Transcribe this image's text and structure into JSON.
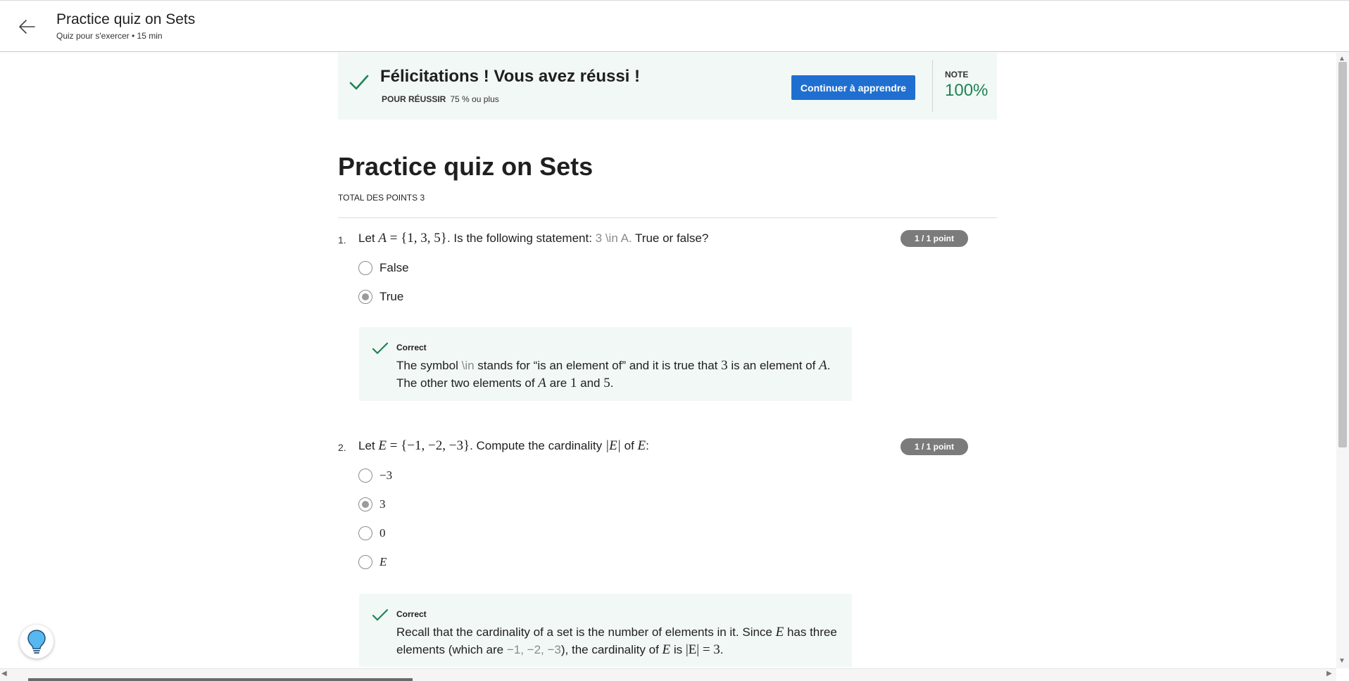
{
  "header": {
    "title": "Practice quiz on Sets",
    "subtitle": "Quiz pour s'exercer • 15  min"
  },
  "banner": {
    "title": "Félicitations ! Vous avez réussi !",
    "pass_label": "POUR RÉUSSIR",
    "pass_value": "75 % ou plus",
    "cta": "Continuer à apprendre",
    "note_label": "NOTE",
    "note_value": "100%"
  },
  "quiz": {
    "title": "Practice quiz on Sets",
    "total_points": "TOTAL DES POINTS 3"
  },
  "q1": {
    "number": "1.",
    "t1": "Let ",
    "m1": "A",
    "m2": " = {1, 3, 5}",
    "t2": ". Is the following statement: ",
    "t3": "3 \\in A.",
    "t4": " True or false?",
    "points": "1 / 1 point",
    "options": [
      "False",
      "True"
    ],
    "feedback_head": "Correct",
    "fb_a": "The symbol ",
    "fb_b": "\\in",
    "fb_c": " stands for “is an element of” and it is true that ",
    "fb_d": "3",
    "fb_e": " is an element of ",
    "fb_f": "A",
    "fb_g": ".",
    "fb_h": "The other two elements of ",
    "fb_i": "A",
    "fb_j": " are ",
    "fb_k": "1",
    "fb_l": " and ",
    "fb_m": "5",
    "fb_n": "."
  },
  "q2": {
    "number": "2.",
    "t1": "Let ",
    "m1": "E",
    "m2": " = {−1, −2, −3}",
    "t2": ". Compute the cardinality ",
    "m3": "|E|",
    "t3": " of ",
    "m4": "E",
    "t4": ":",
    "points": "1 / 1 point",
    "options": [
      "−3",
      "3",
      "0",
      "E"
    ],
    "feedback_head": "Correct",
    "fb_a": "Recall that the cardinality of a set is the number of elements in it. Since ",
    "fb_b": "E",
    "fb_c": " has three",
    "fb_d": "elements (which are ",
    "fb_e": "−1, −2, −3",
    "fb_f": "), the cardinality of ",
    "fb_g": "E",
    "fb_h": " is ",
    "fb_i": "|E| = 3",
    "fb_j": "."
  },
  "colors": {
    "accent": "#1f6fd1",
    "success": "#1f8354",
    "pill": "#7b7b7b",
    "feedback_bg": "#f2f8f6"
  },
  "icons": [
    "back-arrow-icon",
    "check-icon",
    "lightbulb-icon"
  ]
}
